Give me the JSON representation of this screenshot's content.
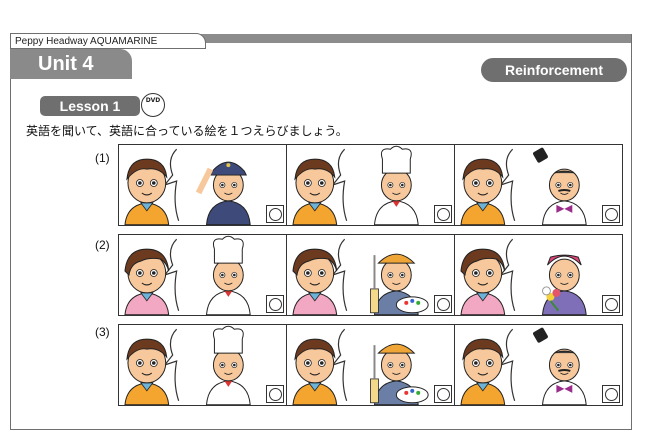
{
  "header": {
    "series": "Peppy Headway AQUAMARINE",
    "unit": "Unit 4",
    "section": "Reinforcement"
  },
  "lesson": {
    "label": "Lesson 1",
    "dvd": "DVD"
  },
  "instruction": "英語を聞いて、英語に合っている絵を１つえらびましょう。",
  "questions": [
    {
      "number": "(1)",
      "speaker": "boy",
      "options": [
        "conductor",
        "chef",
        "magician"
      ]
    },
    {
      "number": "(2)",
      "speaker": "girl",
      "options": [
        "chef",
        "painter",
        "florist"
      ]
    },
    {
      "number": "(3)",
      "speaker": "boy",
      "options": [
        "chef",
        "painter",
        "magician"
      ]
    }
  ],
  "colors": {
    "tab_gray": "#8a8a8a",
    "badge_gray": "#6f6f6f",
    "skin": "#f7c89b",
    "boy_shirt": "#f3a52f",
    "girl_shirt": "#f2a7c3",
    "scarf": "#6db3d8"
  }
}
